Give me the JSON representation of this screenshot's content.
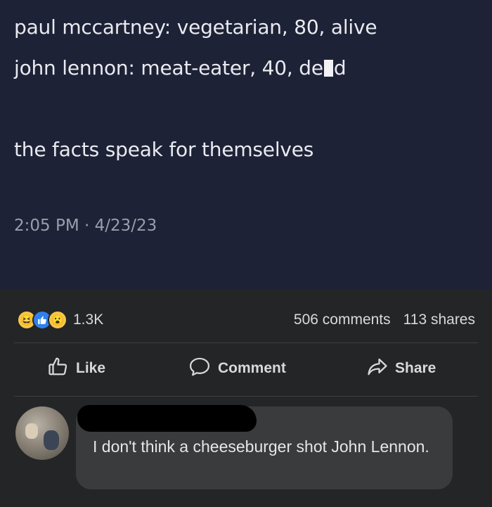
{
  "post": {
    "line1": "paul mccartney: vegetarian, 80, alive",
    "line2_before": "john lennon: meat-eater, 40, de",
    "line2_after": "d",
    "line3": "the facts speak for themselves",
    "timestamp": "2:05 PM · 4/23/23"
  },
  "reactions": {
    "icons": [
      "haha-icon",
      "like-icon",
      "wow-icon"
    ],
    "count": "1.3K"
  },
  "engagement": {
    "comments": "506 comments",
    "shares": "113 shares"
  },
  "actions": {
    "like": "Like",
    "comment": "Comment",
    "share": "Share"
  },
  "comment": {
    "text": "I don't think a cheeseburger shot John Lennon."
  }
}
